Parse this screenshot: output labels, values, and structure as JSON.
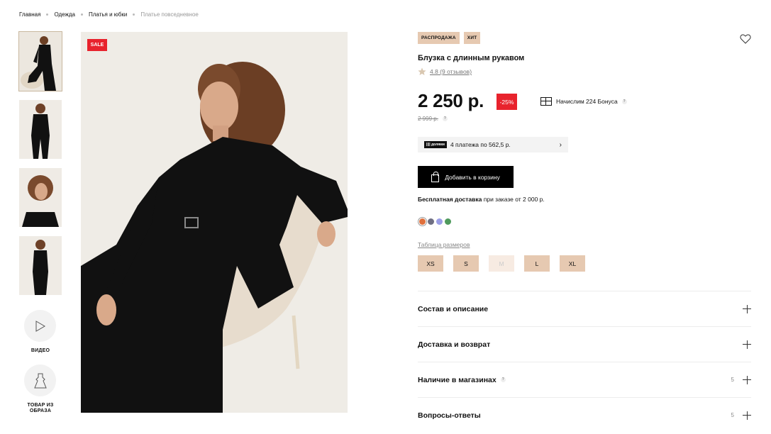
{
  "breadcrumb": {
    "items": [
      "Главная",
      "Одежда",
      "Платья и юбки"
    ],
    "current": "Платье повседневное"
  },
  "gallery": {
    "video_label": "ВИДЕО",
    "outfit_label": "ТОВАР ИЗ ОБРАЗА",
    "sale_badge": "SALE"
  },
  "product": {
    "tags": [
      "РАСПРОДАЖА",
      "ХИТ"
    ],
    "title": "Блузка с длинным рукавом",
    "rating_text": "4.8 (9 отзывов)",
    "price": "2 250 р.",
    "discount": "-25%",
    "bonus": "Начислим 224 Бонуса",
    "old_price": "2 999 р.",
    "installments_logo": "|||| долями",
    "installments": "4 платежа по 562,5 р.",
    "add_to_cart": "Добавить в корзину",
    "delivery_bold": "Бесплатная доставка",
    "delivery_rest": "при заказе от 2 000 р.",
    "size_table": "Таблица размеров",
    "sizes": [
      "XS",
      "S",
      "M",
      "L",
      "XL"
    ],
    "colors": [
      "#e0703c",
      "#6f6f83",
      "#9b9ee6",
      "#4f9a5d"
    ]
  },
  "accordion": [
    {
      "label": "Состав и описание",
      "count": ""
    },
    {
      "label": "Доставка и возврат",
      "count": ""
    },
    {
      "label": "Наличие в магазинах",
      "count": "5"
    },
    {
      "label": "Вопросы-ответы",
      "count": "5"
    }
  ],
  "colors": {
    "accent_red": "#e8232d",
    "tag_beige": "#e6c9b1"
  }
}
